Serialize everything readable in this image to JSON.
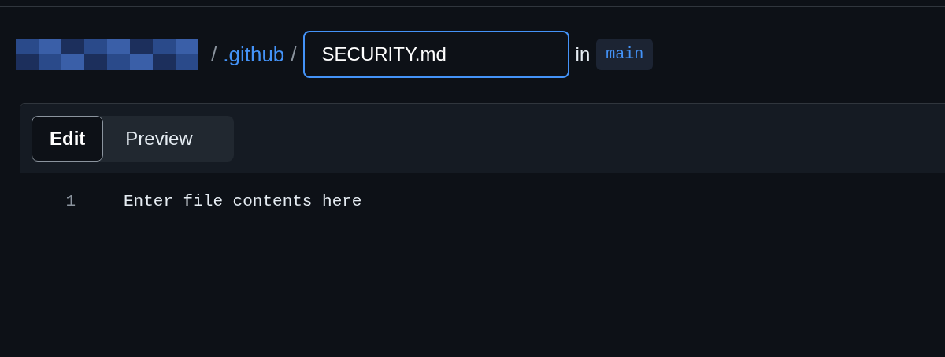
{
  "breadcrumb": [
    {
      "kind": "redacted"
    },
    {
      "kind": "separator",
      "text": "/"
    },
    {
      "kind": "link",
      "text": ".github"
    },
    {
      "kind": "separator",
      "text": "/"
    }
  ],
  "filename": {
    "value": "SECURITY.md"
  },
  "branch_prefix": "in",
  "branch": "main",
  "tabs": [
    {
      "label": "Edit",
      "selected": true
    },
    {
      "label": "Preview",
      "selected": false
    }
  ],
  "editor": {
    "lines": [
      {
        "number": "1",
        "text": "Enter file contents here"
      }
    ]
  }
}
